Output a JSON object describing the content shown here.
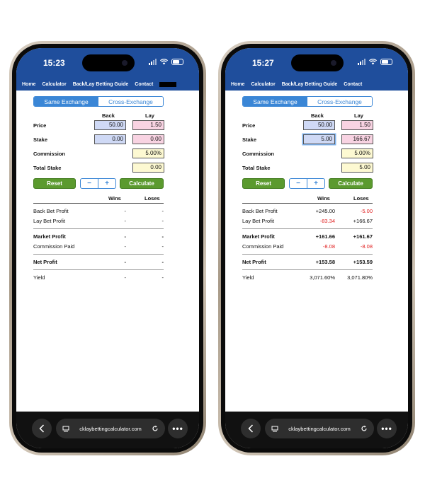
{
  "nav": {
    "home": "Home",
    "calculator": "Calculator",
    "guide": "Back/Lay Betting Guide",
    "contact": "Contact"
  },
  "tabs": {
    "same": "Same Exchange",
    "cross": "Cross-Exchange"
  },
  "columns": {
    "back": "Back",
    "lay": "Lay",
    "wins": "Wins",
    "loses": "Loses"
  },
  "labels": {
    "price": "Price",
    "stake": "Stake",
    "commission": "Commission",
    "total_stake": "Total Stake",
    "back_bet_profit": "Back Bet Profit",
    "lay_bet_profit": "Lay Bet Profit",
    "market_profit": "Market Profit",
    "commission_paid": "Commission Paid",
    "net_profit": "Net Profit",
    "yield": "Yield"
  },
  "buttons": {
    "reset": "Reset",
    "minus": "−",
    "plus": "+",
    "calculate": "Calculate"
  },
  "url": "cklaybettingcalculator.com",
  "colors": {
    "brand_blue": "#1f4e9c",
    "accent_blue": "#3a86d6",
    "green": "#5b9a2e",
    "red": "#e02020"
  },
  "icons": [
    "back-chevron-icon",
    "tabs-icon",
    "reload-icon",
    "more-icon",
    "wifi-icon",
    "battery-icon",
    "signal-icon"
  ],
  "phones": [
    {
      "time": "15:23",
      "back_price": "50.00",
      "lay_price": "1.50",
      "back_stake": "0.00",
      "lay_stake": "0.00",
      "commission": "5.00%",
      "total_stake": "0.00",
      "back_bet_profit": {
        "wins": "-",
        "loses": "-"
      },
      "lay_bet_profit": {
        "wins": "-",
        "loses": "-"
      },
      "market_profit": {
        "wins": "-",
        "loses": "-"
      },
      "commission_paid": {
        "wins": "-",
        "loses": "-"
      },
      "net_profit": {
        "wins": "-",
        "loses": "-"
      },
      "yield": {
        "wins": "-",
        "loses": "-"
      }
    },
    {
      "time": "15:27",
      "back_price": "50.00",
      "lay_price": "1.50",
      "back_stake": "5.00",
      "lay_stake": "166.67",
      "commission": "5.00%",
      "total_stake": "5.00",
      "back_bet_profit": {
        "wins": "+245.00",
        "loses": "-5.00"
      },
      "lay_bet_profit": {
        "wins": "-83.34",
        "loses": "+166.67"
      },
      "market_profit": {
        "wins": "+161.66",
        "loses": "+161.67"
      },
      "commission_paid": {
        "wins": "-8.08",
        "loses": "-8.08"
      },
      "net_profit": {
        "wins": "+153.58",
        "loses": "+153.59"
      },
      "yield": {
        "wins": "3,071.60%",
        "loses": "3,071.80%"
      }
    }
  ]
}
